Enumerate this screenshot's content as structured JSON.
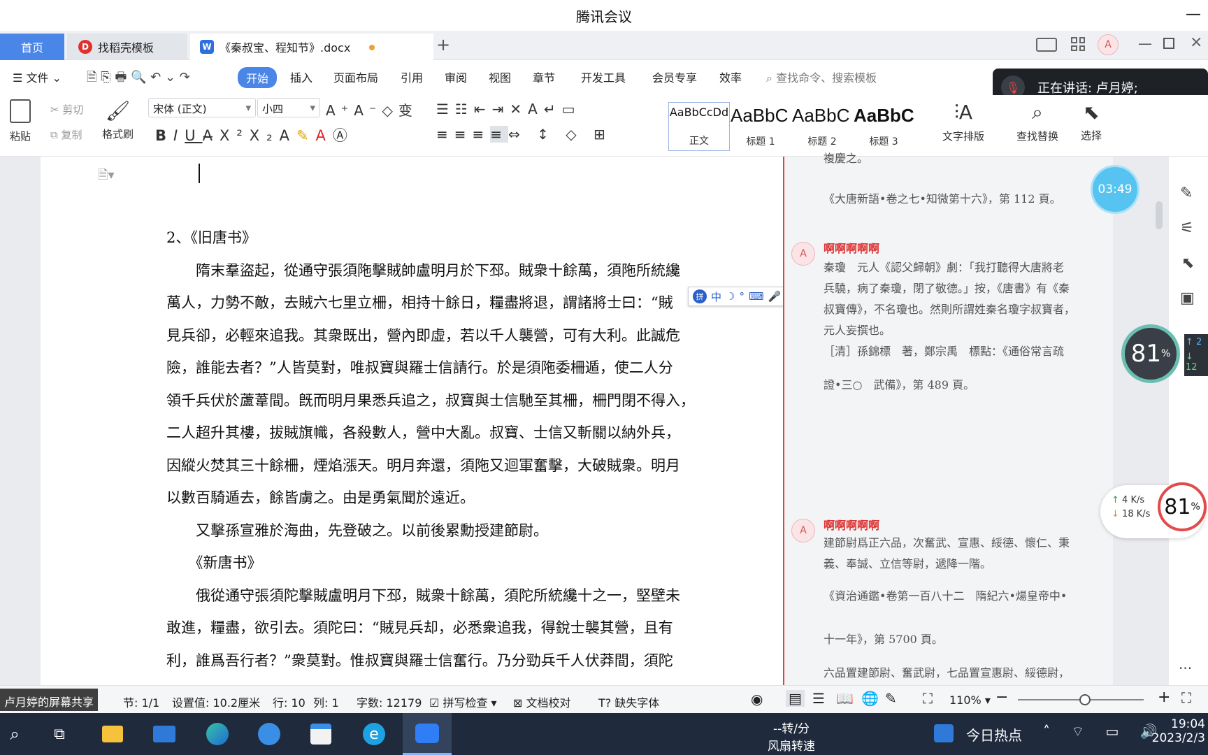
{
  "window": {
    "title": "腾讯会议"
  },
  "tabs": {
    "home": "首页",
    "templates": "找稻壳模板",
    "document": "《秦叔宝、程知节》.docx"
  },
  "menu": {
    "file": "文件",
    "items": [
      "开始",
      "插入",
      "页面布局",
      "引用",
      "审阅",
      "视图",
      "章节",
      "开发工具",
      "会员专享",
      "效率"
    ],
    "search_placeholder": "查找命令、搜索模板"
  },
  "meeting": {
    "speaking": "正在讲话: 卢月婷;",
    "timer": "03:49",
    "screen_share": "卢月婷的屏幕共享"
  },
  "ribbon": {
    "paste": "粘贴",
    "cut": "剪切",
    "copy": "复制",
    "format_painter": "格式刷",
    "font_name": "宋体 (正文)",
    "font_size": "小四",
    "styles": [
      {
        "preview": "AaBbCcDd",
        "label": "正文"
      },
      {
        "preview": "AaBbC",
        "label": "标题 1"
      },
      {
        "preview": "AaBbC",
        "label": "标题 2"
      },
      {
        "preview": "AaBbC",
        "label": "标题 3"
      }
    ],
    "text_layout": "文字排版",
    "find_replace": "查找替换",
    "select": "选择"
  },
  "document": {
    "paragraphs": [
      "2、《旧唐书》",
      "　　隋末羣盜起，從通守張須陁擊賊帥盧明月於下邳。賊衆十餘萬，須陁所統纔",
      "萬人，力勢不敵，去賊六七里立柵，相持十餘日，糧盡將退，謂諸將士曰：“賊",
      "見兵卻，必輕來追我。其衆既出，營內即虛，若以千人襲營，可有大利。此誠危",
      "險，誰能去者？”人皆莫對，唯叔寶與羅士信請行。於是須陁委柵遁，使二人分",
      "領千兵伏於蘆葦間。旣而明月果悉兵追之，叔寶與士信馳至其柵，柵門閉不得入，",
      "二人超升其樓，拔賊旗幟，各殺數人，營中大亂。叔寶、士信又斬關以納外兵，",
      "因縱火焚其三十餘柵，煙焰漲天。明月奔還，須陁又迴軍奮擊，大破賊衆。明月",
      "以數百騎遁去，餘皆虜之。由是勇氣聞於遠近。",
      "　　又擊孫宣雅於海曲，先登破之。以前後累勳授建節尉。",
      "　　《新唐书》",
      "　　俄從通守張須陀擊賊盧明月下邳，賊衆十餘萬，須陀所統纔十之一，堅壁未",
      "敢進，糧盡，欲引去。須陀曰：“賊見兵却，必悉衆追我，得銳士襲其營，且有",
      "利，誰爲吾行者？”衆莫對。惟叔寶與羅士信奮行。乃分勁兵千人伏莽間，須陀"
    ]
  },
  "comments": {
    "top_fragment": "複慶之。",
    "top_source": "《大唐新語•卷之七•知微第十六》，第 112 頁。",
    "c1": {
      "author": "啊啊啊啊啊",
      "lines": [
        "秦瓊　元人《認父歸朝》劇：「我打聽得大唐將老",
        "兵驍，病了秦瓊，閉了敬德。」按，《唐書》有《秦",
        "叔寶傳》，不名瓊也。然則所謂姓秦名瓊字叔寶者，",
        "元人妄撰也。",
        "［清］孫錦標　著，鄭宗禹　標點：《通俗常言疏",
        "證•三○　武備》，第 489 頁。"
      ]
    },
    "c2": {
      "author": "啊啊啊啊啊",
      "lines": [
        "建節尉爲正六品，次奮武、宣惠、綏德、懷仁、秉",
        "義、奉誠、立信等尉，遞降一階。",
        "《資治通鑑•卷第一百八十二　隋紀六•煬皇帝中•",
        "十一年》，第 5700 頁。",
        "六品置建節尉、奮武尉，七品置宣惠尉、綏德尉，"
      ]
    }
  },
  "status": {
    "section": "节: 1/1",
    "setting": "设置值: 10.2厘米",
    "line": "行: 10",
    "col": "列: 1",
    "wordcount": "字数: 12179",
    "spellcheck": "拼写检查",
    "proofread": "文档校对",
    "missing_font": "缺失字体",
    "zoom": "110%"
  },
  "gauges": {
    "cpu_left": "81",
    "cpu_right": "81",
    "up_speed": "4  K/s",
    "down_speed": "18  K/s",
    "side_up": "2",
    "side_down": "12"
  },
  "taskbar": {
    "fan_speed": "--转/分",
    "fan_label": "风扇转速",
    "hot_news": "今日热点",
    "time": "19:04",
    "date": "2023/2/3"
  },
  "colors": {
    "accent": "#4a86e8",
    "comment_author": "#dd3333",
    "taskbar": "#1f2a3d"
  }
}
